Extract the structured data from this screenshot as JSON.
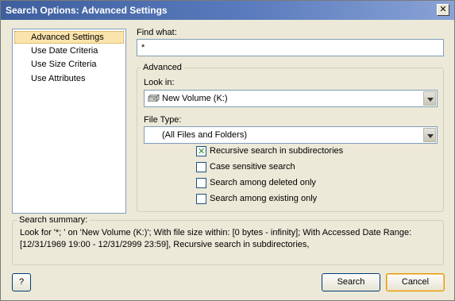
{
  "window": {
    "title": "Search Options: Advanced Settings",
    "close_glyph": "✕"
  },
  "nav": {
    "items": [
      {
        "label": "Advanced Settings",
        "selected": true
      },
      {
        "label": "Use Date Criteria"
      },
      {
        "label": "Use Size Criteria"
      },
      {
        "label": "Use Attributes"
      }
    ]
  },
  "find": {
    "label": "Find what:",
    "value": "*"
  },
  "advanced": {
    "title": "Advanced",
    "look_in_label": "Look in:",
    "look_in_value": "New Volume (K:)",
    "file_type_label": "File Type:",
    "file_type_value": "(All Files and Folders)",
    "options": [
      {
        "label": "Recursive search in subdirectories",
        "checked": true
      },
      {
        "label": "Case sensitive search",
        "checked": false
      },
      {
        "label": "Search among deleted only",
        "checked": false
      },
      {
        "label": "Search among existing only",
        "checked": false
      }
    ]
  },
  "summary": {
    "title": "Search summary:",
    "text": "Look for '*; ' on 'New Volume (K:)'; With file size within: [0 bytes - infinity]; With Accessed Date Range: [12/31/1969 19:00 - 12/31/2999 23:59], Recursive search in subdirectories,"
  },
  "buttons": {
    "help": "?",
    "search": "Search",
    "cancel": "Cancel"
  }
}
